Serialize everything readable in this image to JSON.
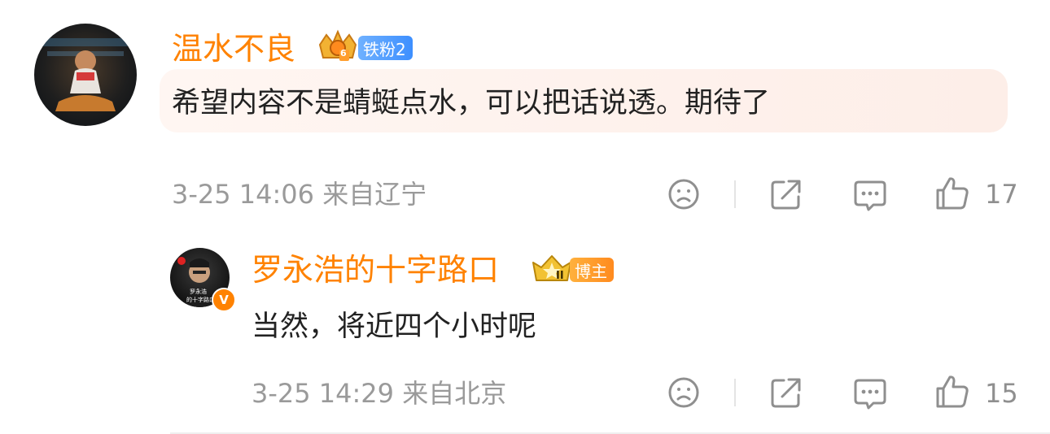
{
  "comment": {
    "username": "温水不良",
    "fan_badge": "铁粉2",
    "crown_level": "6",
    "text": "希望内容不是蜻蜓点水，可以把话说透。期待了",
    "meta": "3-25 14:06 来自辽宁",
    "like_count": "17"
  },
  "reply": {
    "username": "罗永浩的十字路口",
    "author_badge": "博主",
    "crown_level": "II",
    "text": "当然，将近四个小时呢",
    "meta": "3-25 14:29 来自北京",
    "like_count": "15",
    "verified_mark": "V",
    "avatar_caption_1": "罗永浩",
    "avatar_caption_2": "的十字路口"
  },
  "colors": {
    "username": "#ff8200",
    "text": "#222222",
    "meta": "#9a9a9a",
    "icon": "#8f8f8f"
  }
}
